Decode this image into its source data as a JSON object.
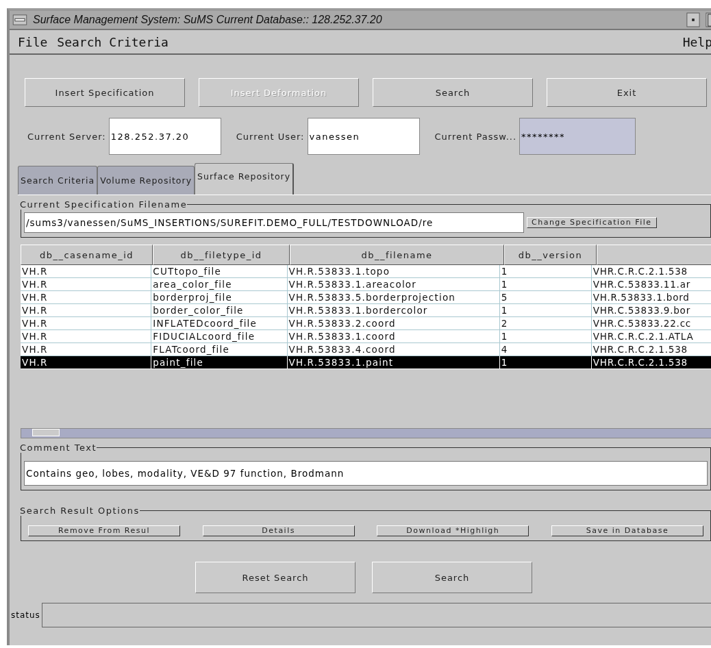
{
  "window": {
    "title": "Surface Management System: SuMS Current Database:: 128.252.37.20"
  },
  "menu": {
    "left": [
      "File",
      "Search Criteria"
    ],
    "right": "Help"
  },
  "toolbar": [
    {
      "label": "Insert Specification",
      "disabled": false
    },
    {
      "label": "Insert Deformation",
      "disabled": true
    },
    {
      "label": "Search",
      "disabled": false
    },
    {
      "label": "Exit",
      "disabled": false
    }
  ],
  "fields": [
    {
      "label": "Current Server:",
      "value": "128.252.37.20",
      "readonly": false
    },
    {
      "label": "Current User:",
      "value": "vanessen",
      "readonly": false
    },
    {
      "label": "Current Passw...",
      "value": "********",
      "readonly": true
    }
  ],
  "tabs": [
    {
      "label": "Search Criteria",
      "selected": false
    },
    {
      "label": "Volume Repository",
      "selected": false
    },
    {
      "label": "Surface Repository",
      "selected": true
    }
  ],
  "spec": {
    "title": "Current Specification Filename",
    "value": "/sums3/vanessen/SuMS_INSERTIONS/SUREFIT.DEMO_FULL/TESTDOWNLOAD/re",
    "button": "Change Specification File"
  },
  "table": {
    "columns": [
      "db__casename_id",
      "db__filetype_id",
      "db__filename",
      "db__version"
    ],
    "rows": [
      {
        "cells": [
          "VH.R",
          "CUTtopo_file",
          "VH.R.53833.1.topo",
          "1",
          "VHR.C.R.C.2.1.538"
        ],
        "selected": false
      },
      {
        "cells": [
          "VH.R",
          "area_color_file",
          "VH.R.53833.1.areacolor",
          "1",
          "VHR.C.53833.11.ar"
        ],
        "selected": false
      },
      {
        "cells": [
          "VH.R",
          "borderproj_file",
          "VH.R.53833.5.borderprojection",
          "5",
          "VH.R.53833.1.bord"
        ],
        "selected": false
      },
      {
        "cells": [
          "VH.R",
          "border_color_file",
          "VH.R.53833.1.bordercolor",
          "1",
          "VHR.C.53833.9.bor"
        ],
        "selected": false
      },
      {
        "cells": [
          "VH.R",
          "INFLATEDcoord_file",
          "VH.R.53833.2.coord",
          "2",
          "VHR.C.53833.22.cc"
        ],
        "selected": false
      },
      {
        "cells": [
          "VH.R",
          "FIDUCIALcoord_file",
          "VH.R.53833.1.coord",
          "1",
          "VHR.C.R.C.2.1.ATLA"
        ],
        "selected": false
      },
      {
        "cells": [
          "VH.R",
          "FLATcoord_file",
          "VH.R.53833.4.coord",
          "4",
          "VHR.C.R.C.2.1.538"
        ],
        "selected": false
      },
      {
        "cells": [
          "VH.R",
          "paint_file",
          "VH.R.53833.1.paint",
          "1",
          "VHR.C.R.C.2.1.538"
        ],
        "selected": true
      }
    ]
  },
  "comment": {
    "title": "Comment Text",
    "value": "Contains geo, lobes, modality, VE&D 97 function, Brodmann"
  },
  "result_options": {
    "title": "Search Result Options",
    "buttons": [
      "Remove From Resul",
      "Details",
      "Download *Highligh",
      "Save in Database"
    ]
  },
  "bottom_buttons": [
    "Reset Search",
    "Search"
  ],
  "status_bar": {
    "label": "status"
  }
}
